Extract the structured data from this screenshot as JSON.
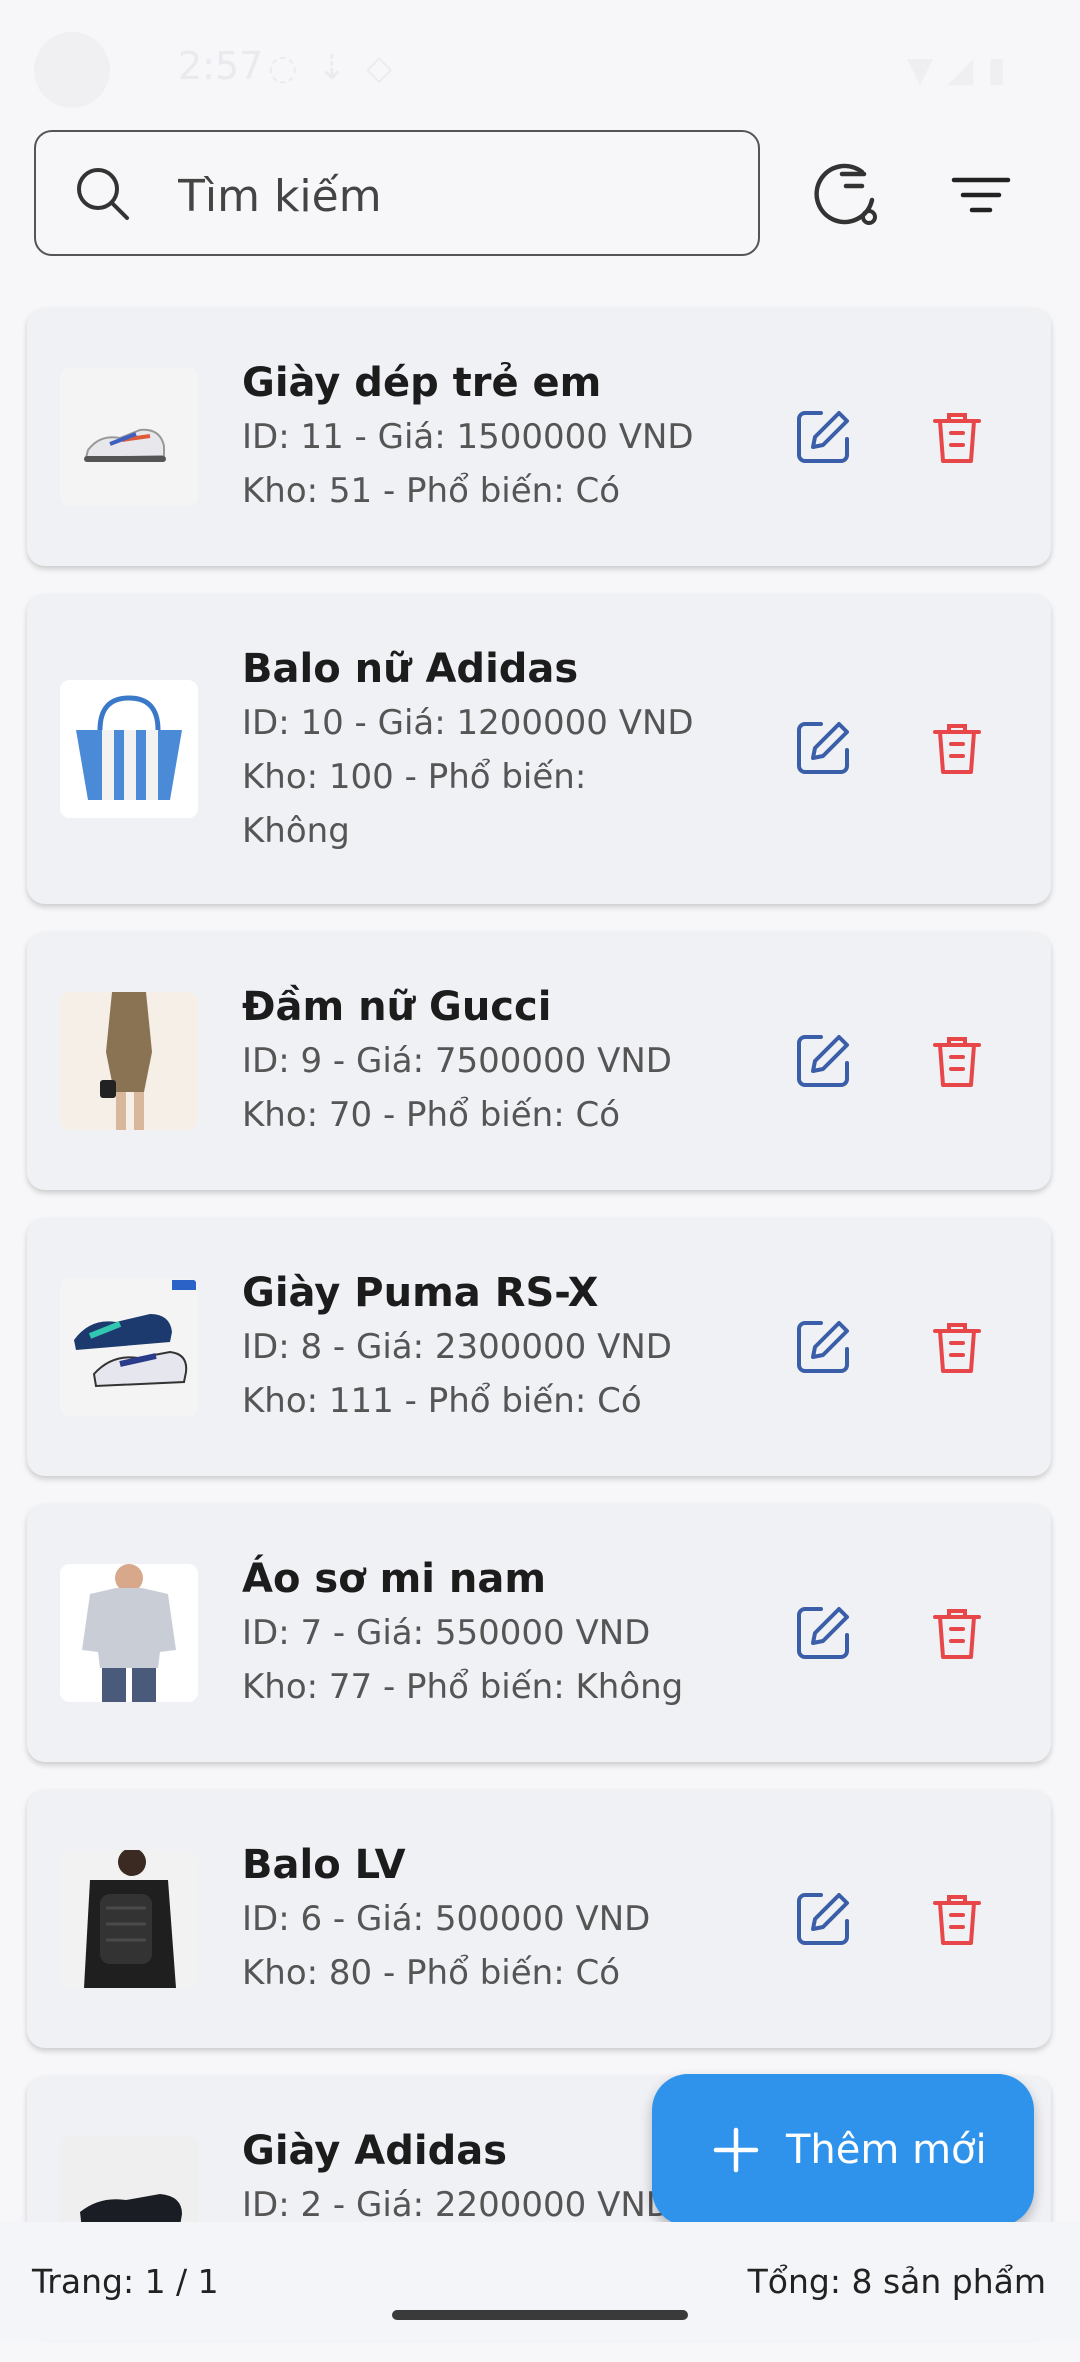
{
  "status_bar": {
    "time": "2:57"
  },
  "search": {
    "placeholder": "Tìm kiếm",
    "value": ""
  },
  "products": [
    {
      "name": "Giày dép trẻ em",
      "line1": "ID: 11 - Giá: 1500000 VND",
      "line2": "Kho: 51 - Phổ biến: Có",
      "line3": ""
    },
    {
      "name": "Balo nữ Adidas",
      "line1": "ID: 10 - Giá: 1200000 VND",
      "line2": "Kho: 100 - Phổ biến:",
      "line3": "Không"
    },
    {
      "name": "Đầm nữ Gucci",
      "line1": "ID: 9 - Giá: 7500000 VND",
      "line2": "Kho: 70 - Phổ biến: Có",
      "line3": ""
    },
    {
      "name": "Giày Puma RS-X",
      "line1": "ID: 8 - Giá: 2300000 VND",
      "line2": "Kho: 111 - Phổ biến: Có",
      "line3": ""
    },
    {
      "name": "Áo sơ mi nam",
      "line1": "ID: 7 - Giá: 550000 VND",
      "line2": "Kho: 77 - Phổ biến: Không",
      "line3": ""
    },
    {
      "name": "Balo LV",
      "line1": "ID: 6 - Giá: 500000 VND",
      "line2": "Kho: 80 - Phổ biến: Có",
      "line3": ""
    },
    {
      "name": "Giày Adidas",
      "line1": "ID: 2 - Giá: 2200000 VND",
      "line2": "",
      "line3": ""
    }
  ],
  "fab": {
    "label": "Thêm mới"
  },
  "footer": {
    "page": "Trang: 1 / 1",
    "total": "Tổng: 8 sản phẩm"
  },
  "colors": {
    "accent": "#2f93ec",
    "edit": "#3b5ea8",
    "delete": "#e8474a",
    "card": "#f0f1f5"
  },
  "icons": {
    "search": "search-icon",
    "history": "history-icon",
    "filter": "filter-icon",
    "edit": "edit-icon",
    "delete": "trash-icon",
    "add": "plus-icon"
  }
}
